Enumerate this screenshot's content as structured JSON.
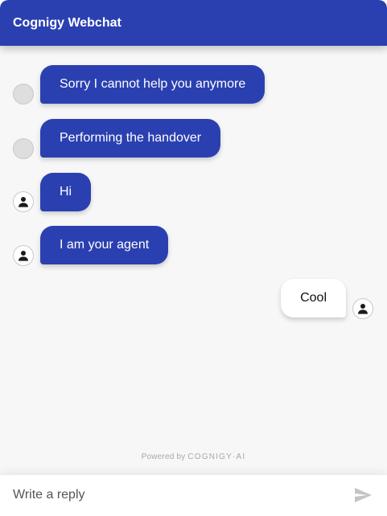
{
  "header": {
    "title": "Cognigy Webchat"
  },
  "messages": [
    {
      "source": "bot",
      "text": "Sorry I cannot help you anymore",
      "avatar": "blank"
    },
    {
      "source": "bot",
      "text": "Performing the handover",
      "avatar": "blank"
    },
    {
      "source": "agent",
      "text": "Hi",
      "avatar": "person-icon"
    },
    {
      "source": "agent",
      "text": "I am your agent",
      "avatar": "person-icon"
    },
    {
      "source": "user",
      "text": "Cool",
      "avatar": "person-icon"
    }
  ],
  "branding": {
    "powered_by": "Powered by",
    "brand": "COGNIGY·AI"
  },
  "input": {
    "placeholder": "Write a reply",
    "value": ""
  },
  "colors": {
    "accent": "#2b40b0",
    "background": "#f7f7f7",
    "user_bubble": "#ffffff"
  },
  "icons": {
    "send": "send-icon",
    "avatar": "person-icon"
  }
}
